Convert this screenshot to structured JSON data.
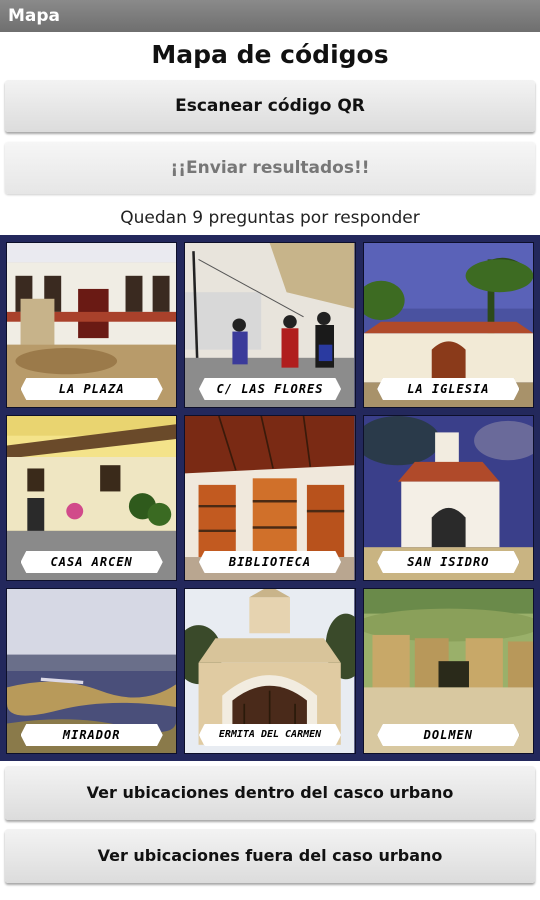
{
  "appbar": {
    "title": "Mapa"
  },
  "header": {
    "title": "Mapa de códigos"
  },
  "buttons": {
    "scan_qr": "Escanear código QR",
    "send_results": "¡¡Enviar resultados!!",
    "urban_locations": "Ver ubicaciones dentro del casco urbano",
    "rural_locations": "Ver ubicaciones fuera del caso urbano"
  },
  "status": {
    "remaining": "Quedan 9 preguntas por responder"
  },
  "locations": [
    {
      "label": "LA PLAZA"
    },
    {
      "label": "C/ LAS FLORES"
    },
    {
      "label": "LA IGLESIA"
    },
    {
      "label": "CASA ARCEN"
    },
    {
      "label": "BIBLIOTECA"
    },
    {
      "label": "SAN ISIDRO"
    },
    {
      "label": "MIRADOR"
    },
    {
      "label": "ERMITA DEL CARMEN"
    },
    {
      "label": "DOLMEN"
    }
  ],
  "colors": {
    "appbar": "#7a7a7a",
    "grid_bg": "#23285c",
    "button_bg": "#e6e6e6"
  }
}
